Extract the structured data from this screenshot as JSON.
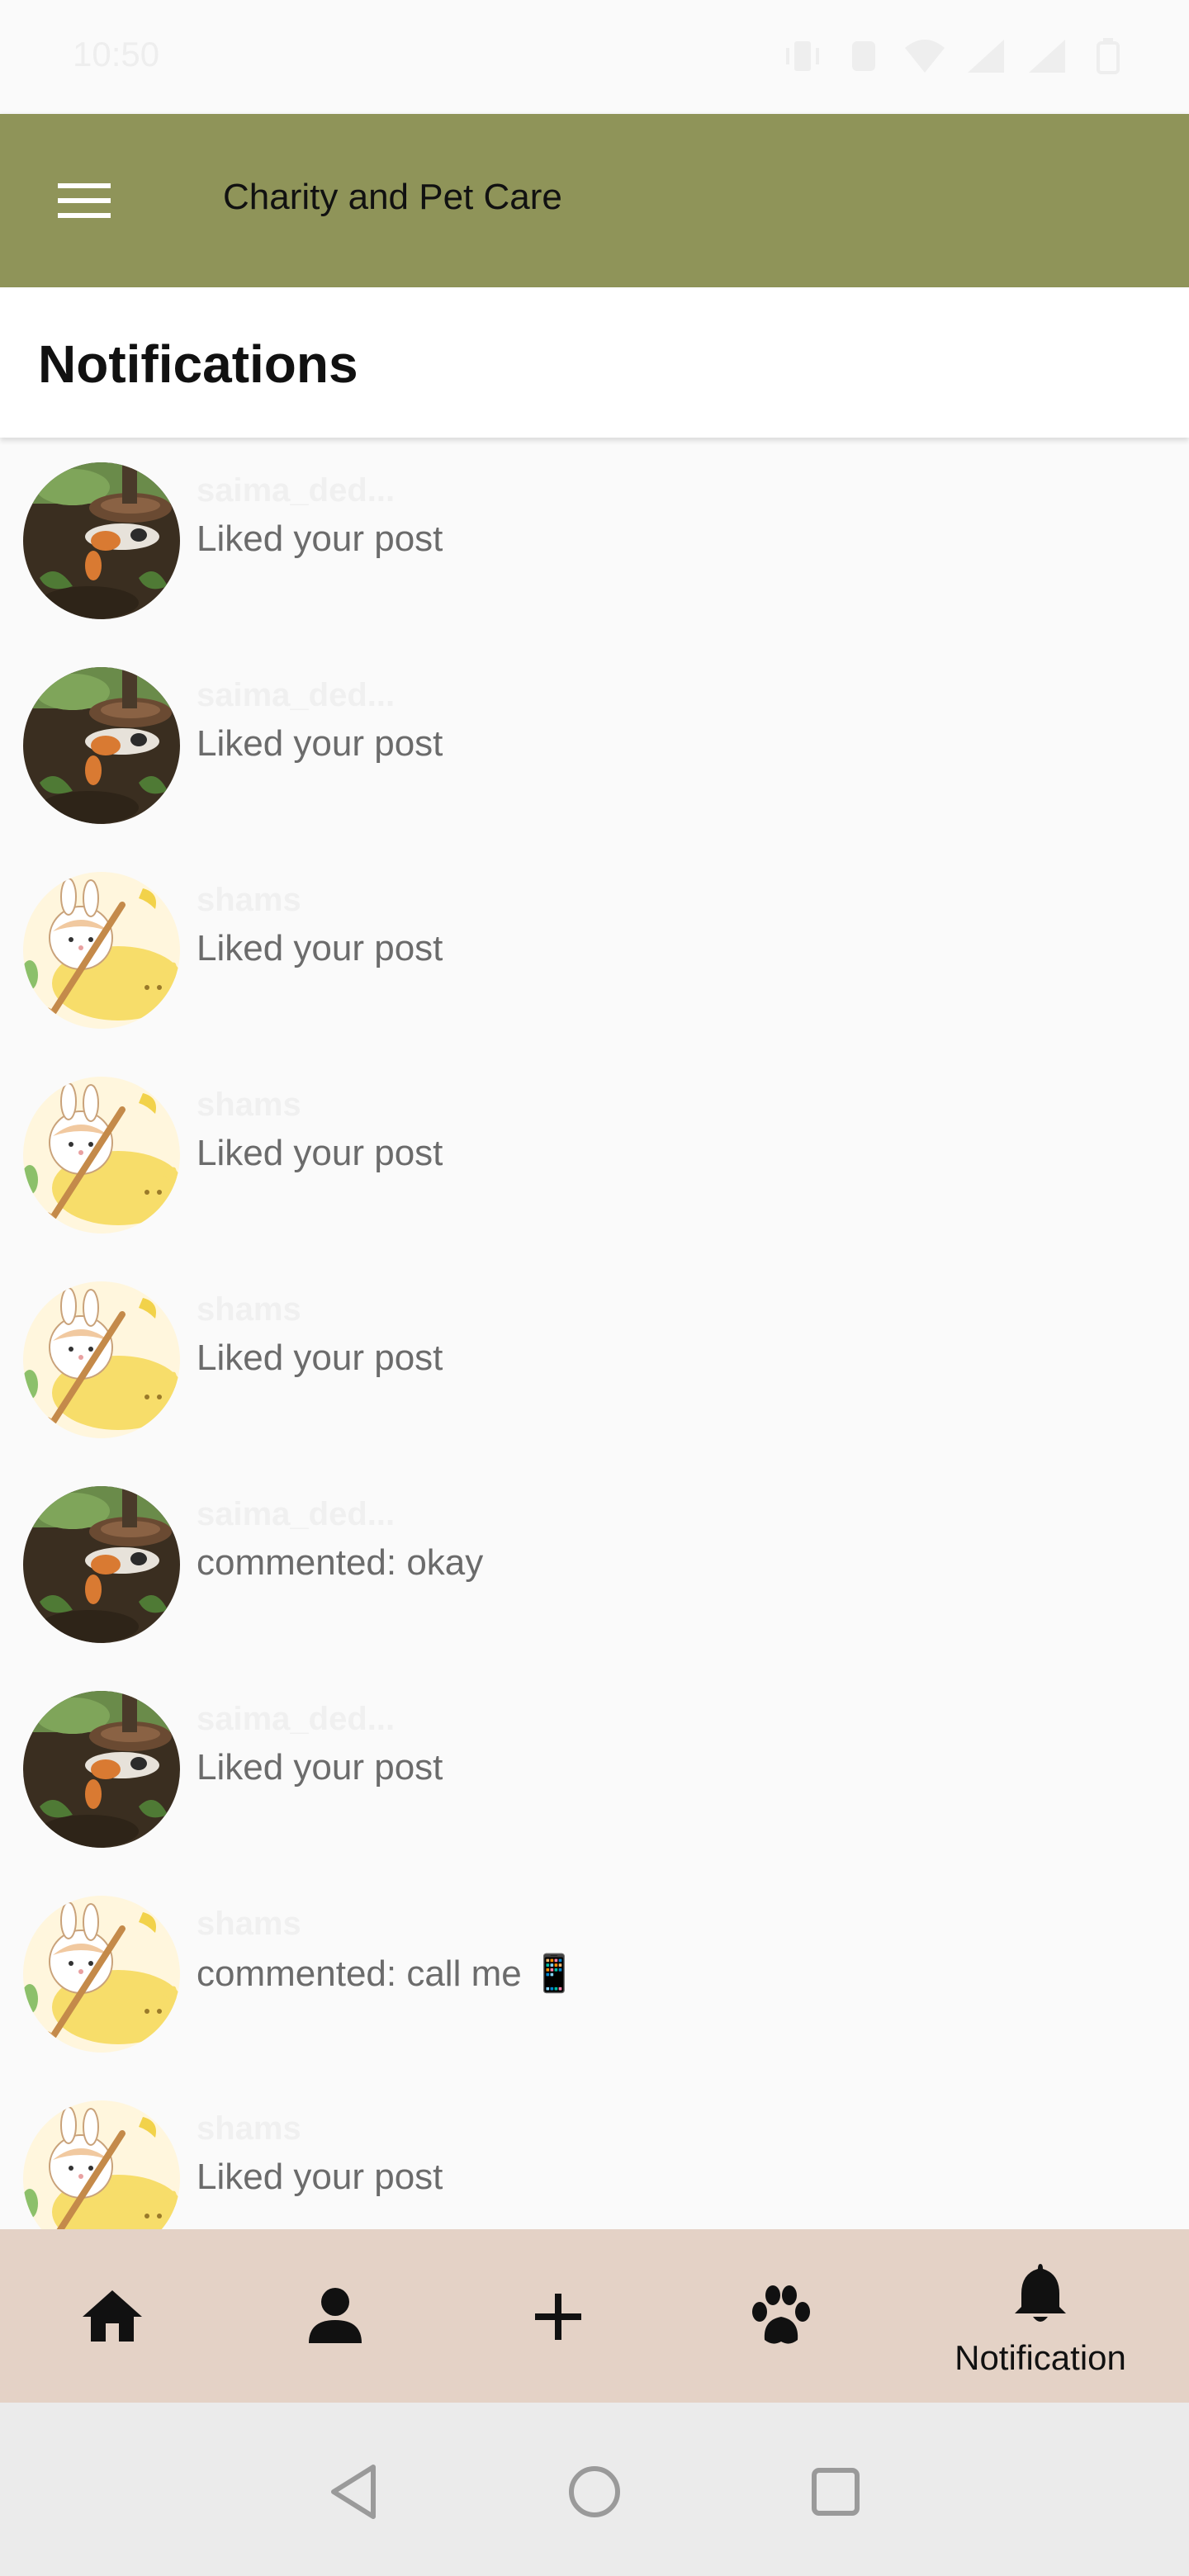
{
  "status_bar": {
    "time": "10:50",
    "icons": [
      "vibrate-icon",
      "data-icon",
      "wifi-icon",
      "signal-icon",
      "signal-x-icon",
      "battery-icon"
    ]
  },
  "app_bar": {
    "title": "Charity and Pet Care",
    "menu_icon": "hamburger-menu-icon"
  },
  "header": {
    "title": "Notifications"
  },
  "notifications": [
    {
      "user": "saima_ded...",
      "text": "Liked your post",
      "avatar": "dog-photo"
    },
    {
      "user": "saima_ded...",
      "text": "Liked your post",
      "avatar": "dog-photo"
    },
    {
      "user": "shams",
      "text": "Liked your post",
      "avatar": "bunny-cartoon"
    },
    {
      "user": "shams",
      "text": "Liked your post",
      "avatar": "bunny-cartoon"
    },
    {
      "user": "shams",
      "text": "Liked your post",
      "avatar": "bunny-cartoon"
    },
    {
      "user": "saima_ded...",
      "text": "commented: okay",
      "avatar": "dog-photo"
    },
    {
      "user": "saima_ded...",
      "text": "Liked your post",
      "avatar": "dog-photo"
    },
    {
      "user": "shams",
      "text": "commented: call me 📱",
      "avatar": "bunny-cartoon"
    },
    {
      "user": "shams",
      "text": "Liked your post",
      "avatar": "bunny-cartoon"
    }
  ],
  "bottom_nav": {
    "items": [
      {
        "icon": "home-icon",
        "label": ""
      },
      {
        "icon": "person-icon",
        "label": ""
      },
      {
        "icon": "plus-icon",
        "label": ""
      },
      {
        "icon": "paw-icon",
        "label": ""
      },
      {
        "icon": "bell-icon",
        "label": "Notification",
        "active": true
      }
    ]
  },
  "colors": {
    "app_bar": "#8f9459",
    "bottom_nav": "#e4d2c6",
    "background": "#fafafa"
  }
}
